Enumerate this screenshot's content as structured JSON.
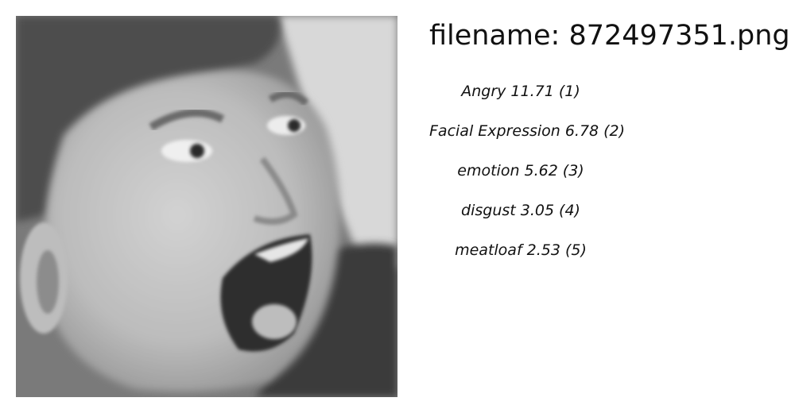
{
  "filename_label": "filename: 872497351.png",
  "photo": {
    "description_icon": "face-photo",
    "tone": "grayscale"
  },
  "labels": [
    {
      "name": "Angry",
      "score": "11.71",
      "rank": "(1)"
    },
    {
      "name": "Facial Expression",
      "score": "6.78",
      "rank": "(2)"
    },
    {
      "name": "emotion",
      "score": "5.62",
      "rank": "(3)"
    },
    {
      "name": "disgust",
      "score": "3.05",
      "rank": "(4)"
    },
    {
      "name": "meatloaf",
      "score": "2.53",
      "rank": "(5)"
    }
  ]
}
